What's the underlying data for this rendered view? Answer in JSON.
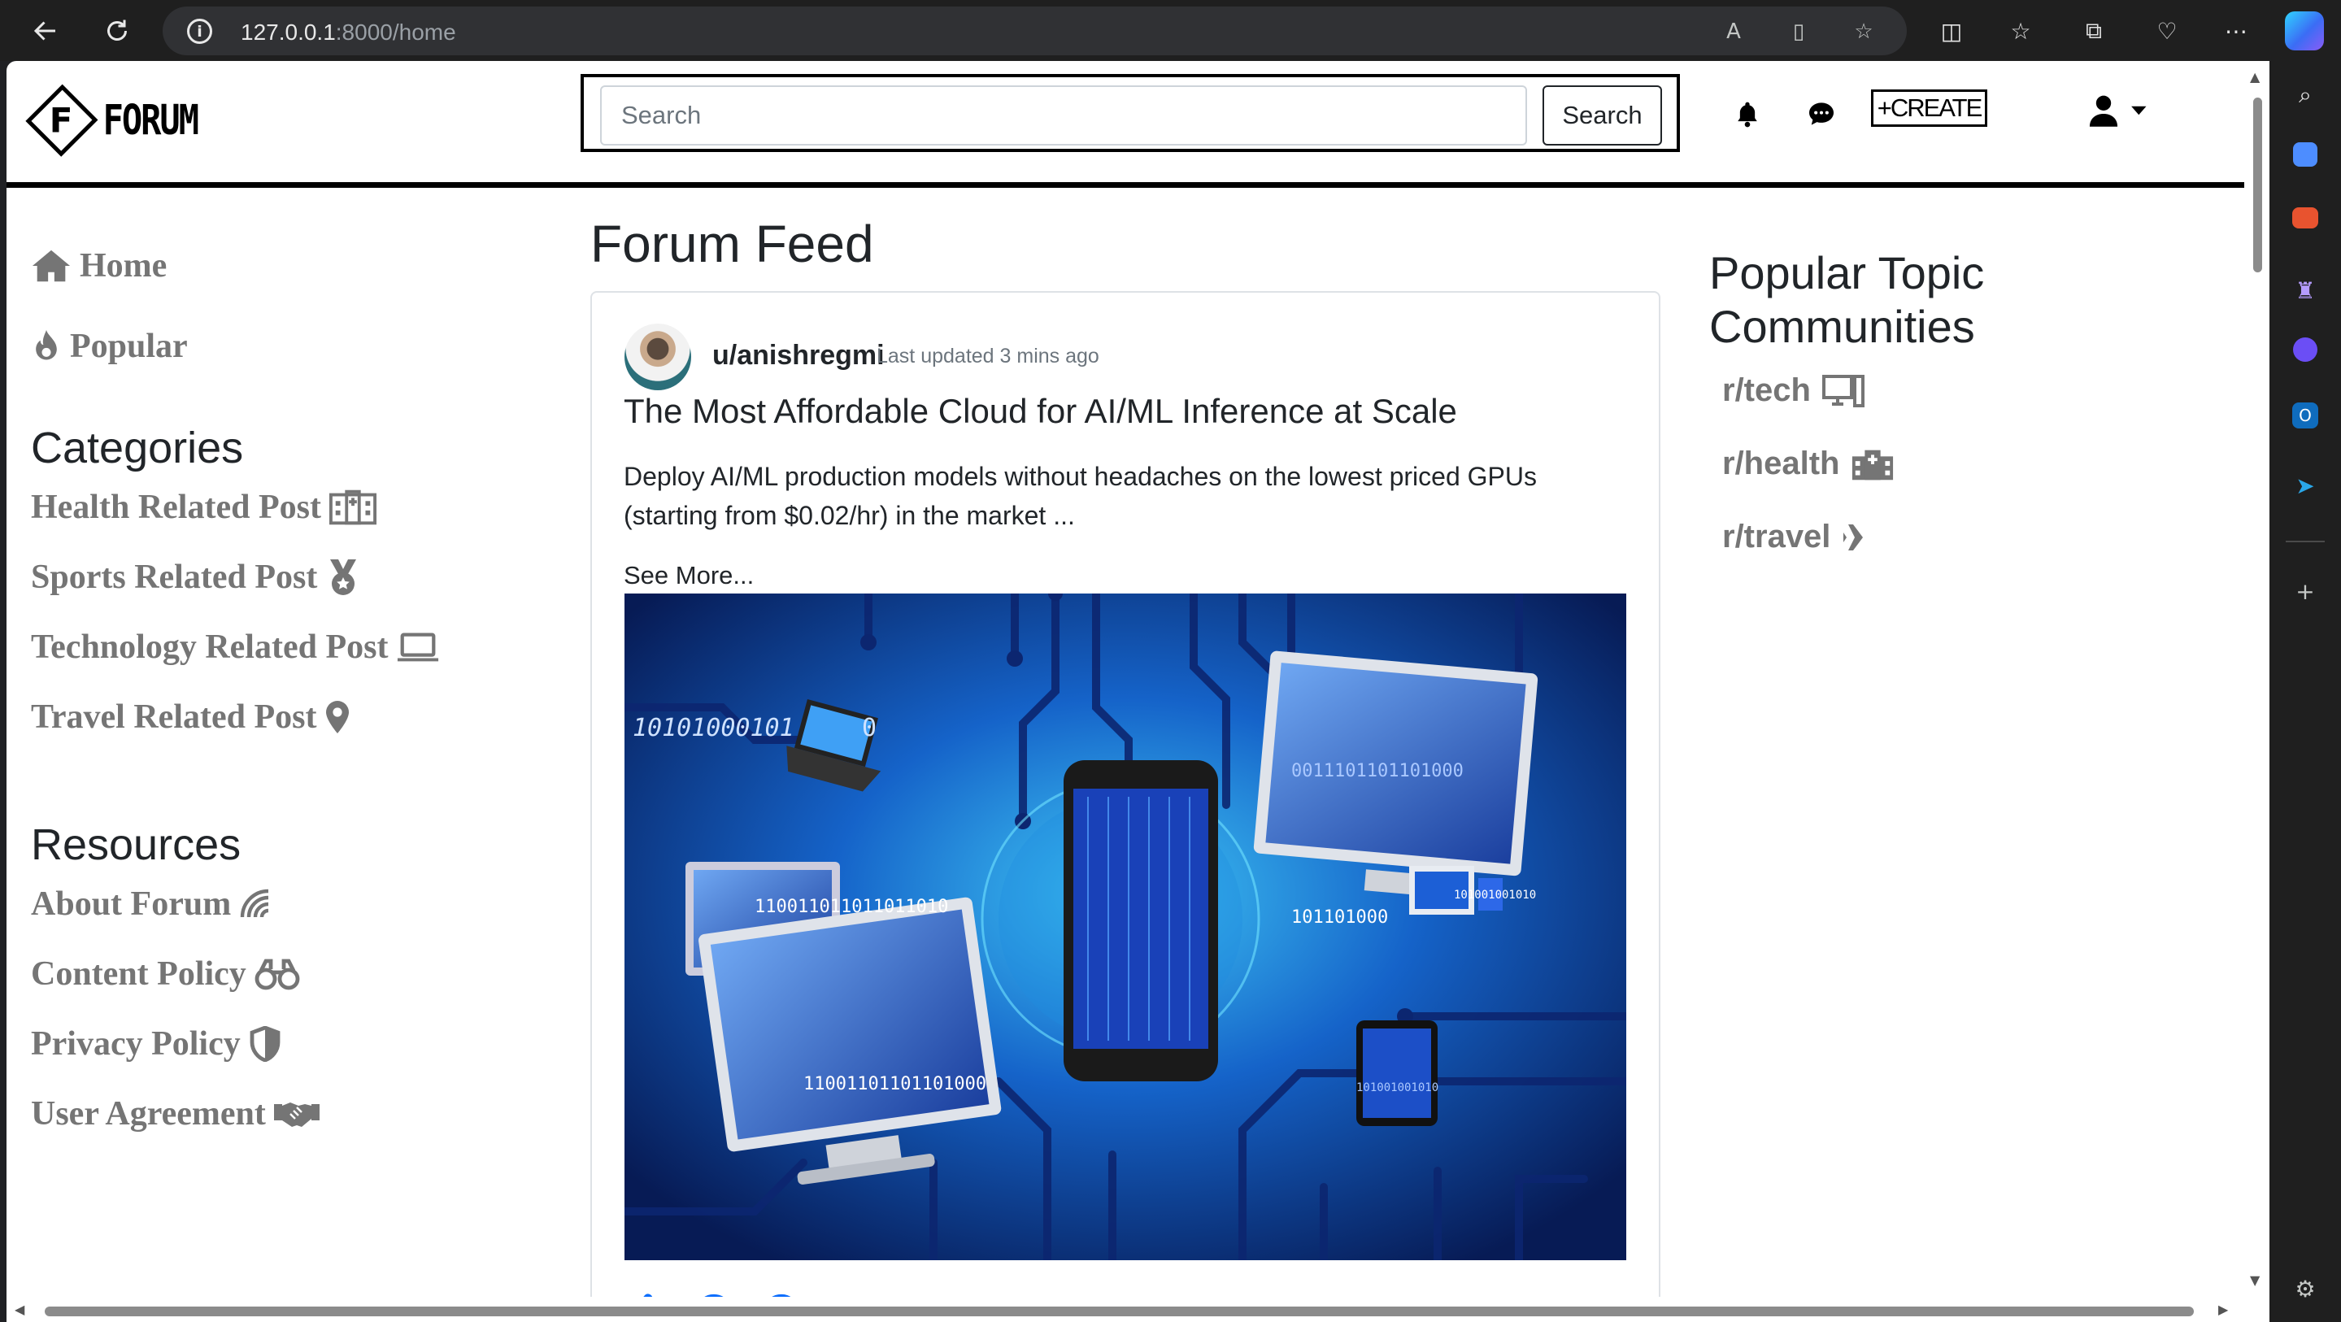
{
  "browser": {
    "url_host": "127.0.0.1",
    "url_rest": ":8000/home"
  },
  "header": {
    "logo_letter": "F",
    "logo_text": "FORUM",
    "search_placeholder": "Search",
    "search_button": "Search",
    "create_label": "+CREATE"
  },
  "sidebar": {
    "nav": [
      {
        "label": "Home",
        "icon": "home-icon"
      },
      {
        "label": "Popular",
        "icon": "fire-icon"
      }
    ],
    "categories_heading": "Categories",
    "categories": [
      {
        "label": "Health Related Post",
        "icon": "hospital-icon"
      },
      {
        "label": "Sports Related Post",
        "icon": "medal-icon"
      },
      {
        "label": "Technology Related Post",
        "icon": "laptop-icon"
      },
      {
        "label": "Travel Related Post",
        "icon": "location-pin-icon"
      }
    ],
    "resources_heading": "Resources",
    "resources": [
      {
        "label": "About Forum",
        "icon": "wifi-icon"
      },
      {
        "label": "Content Policy",
        "icon": "binoculars-icon"
      },
      {
        "label": "Privacy Policy",
        "icon": "shield-icon"
      },
      {
        "label": "User Agreement",
        "icon": "handshake-icon"
      }
    ]
  },
  "feed": {
    "title": "Forum Feed",
    "post": {
      "author": "u/anishregmi",
      "updated": "Last updated 3 mins ago",
      "title": "The Most Affordable Cloud for AI/ML Inference at Scale",
      "body": "Deploy AI/ML production models without headaches on the lowest priced GPUs (starting from $0.02/hr) in the market ...",
      "see_more": "See More...",
      "image_text": [
        "10101000101",
        "0",
        "110011011011011010",
        "11001101101101000",
        "101101000",
        "0011101101101000",
        "101001001010",
        "101001001010"
      ]
    }
  },
  "popular": {
    "title_line1": "Popular Topic",
    "title_line2": "Communities",
    "communities": [
      {
        "label": "r/tech",
        "icon": "desktop-icon"
      },
      {
        "label": "r/health",
        "icon": "hospital-icon"
      },
      {
        "label": "r/travel",
        "icon": "plane-icon"
      }
    ]
  },
  "colors": {
    "accent": "#0d6efd",
    "muted": "#757575",
    "text": "#212529"
  }
}
